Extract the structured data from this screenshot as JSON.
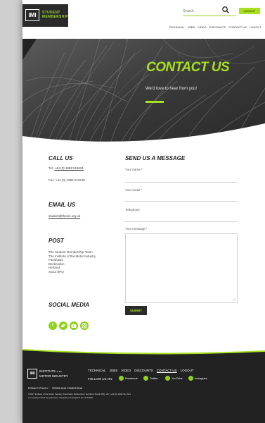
{
  "header": {
    "logo_mark": "IMI",
    "logo_line1": "STUDENT",
    "logo_line2": "MEMBERSHIP",
    "search_placeholder": "Search",
    "logout_label": "LOGOUT",
    "nav": [
      "TECHNICAL",
      "JOBS",
      "VIDEO",
      "DISCOUNTS",
      "CONTACT US",
      "LOGOUT"
    ]
  },
  "hero": {
    "title": "CONTACT US",
    "subtitle": "We'd love to hear from you!"
  },
  "contact": {
    "call_heading": "CALL US",
    "tel_label": "Tel:",
    "tel_value": "+44 (0) 1992 511521",
    "fax_text": "Fax: +44 (0) 1992 511548",
    "email_heading": "EMAIL US",
    "email_value": "student@theimi.org.uk",
    "post_heading": "POST",
    "address": [
      "The Student Membership Team",
      "The Institute of the Motor Industry",
      "Fanshaws",
      "Brickendon",
      "Hertford",
      "SG13 8PQ"
    ],
    "social_heading": "SOCIAL MEDIA",
    "social_icons": [
      "facebook-icon",
      "twitter-icon",
      "youtube-icon",
      "instagram-icon"
    ]
  },
  "form": {
    "heading": "SEND US A MESSAGE",
    "name_label": "Your name *",
    "email_label": "Your email *",
    "phone_label": "Telephone",
    "message_label": "Your message *",
    "submit_label": "SUBMIT"
  },
  "footer": {
    "logo_mark": "IMI",
    "brand_line1": "INSTITUTE",
    "brand_line1_small": "of the",
    "brand_line2": "MOTOR INDUSTRY",
    "nav": [
      "TECHNICAL",
      "JOBS",
      "VIDEO",
      "DISCOUNTS",
      "CONTACT US",
      "LOGOUT"
    ],
    "follow_label": "FOLLOW US ON",
    "social": [
      "Facebook",
      "Twitter",
      "YouTube",
      "Instagram"
    ],
    "legal_links": [
      "PRIVACY POLICY",
      "TERMS AND CONDITIONS"
    ],
    "copyright": "©2017 Institute of the Motor Industry. Fanshaws, Brickendon, Hertford, SG13 8PQ, UK | +44 (0) 1992 511 521",
    "company_line": "A company limited by guarantee. Registered in England No. 2176990"
  },
  "colors": {
    "accent": "#a8e01e",
    "dark": "#222222",
    "hero_bg": "#3d3d3d"
  }
}
